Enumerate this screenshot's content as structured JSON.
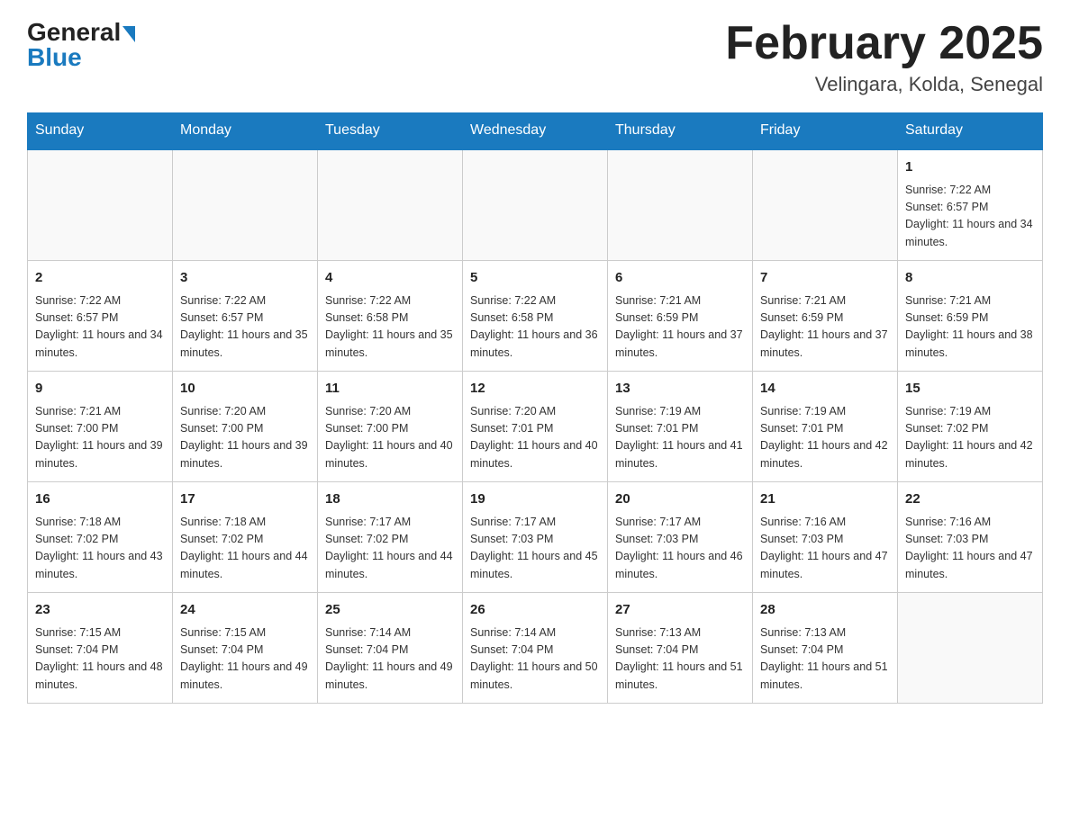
{
  "header": {
    "logo_general": "General",
    "logo_blue": "Blue",
    "title": "February 2025",
    "subtitle": "Velingara, Kolda, Senegal"
  },
  "days_of_week": [
    "Sunday",
    "Monday",
    "Tuesday",
    "Wednesday",
    "Thursday",
    "Friday",
    "Saturday"
  ],
  "weeks": [
    [
      {
        "day": "",
        "info": ""
      },
      {
        "day": "",
        "info": ""
      },
      {
        "day": "",
        "info": ""
      },
      {
        "day": "",
        "info": ""
      },
      {
        "day": "",
        "info": ""
      },
      {
        "day": "",
        "info": ""
      },
      {
        "day": "1",
        "info": "Sunrise: 7:22 AM\nSunset: 6:57 PM\nDaylight: 11 hours and 34 minutes."
      }
    ],
    [
      {
        "day": "2",
        "info": "Sunrise: 7:22 AM\nSunset: 6:57 PM\nDaylight: 11 hours and 34 minutes."
      },
      {
        "day": "3",
        "info": "Sunrise: 7:22 AM\nSunset: 6:57 PM\nDaylight: 11 hours and 35 minutes."
      },
      {
        "day": "4",
        "info": "Sunrise: 7:22 AM\nSunset: 6:58 PM\nDaylight: 11 hours and 35 minutes."
      },
      {
        "day": "5",
        "info": "Sunrise: 7:22 AM\nSunset: 6:58 PM\nDaylight: 11 hours and 36 minutes."
      },
      {
        "day": "6",
        "info": "Sunrise: 7:21 AM\nSunset: 6:59 PM\nDaylight: 11 hours and 37 minutes."
      },
      {
        "day": "7",
        "info": "Sunrise: 7:21 AM\nSunset: 6:59 PM\nDaylight: 11 hours and 37 minutes."
      },
      {
        "day": "8",
        "info": "Sunrise: 7:21 AM\nSunset: 6:59 PM\nDaylight: 11 hours and 38 minutes."
      }
    ],
    [
      {
        "day": "9",
        "info": "Sunrise: 7:21 AM\nSunset: 7:00 PM\nDaylight: 11 hours and 39 minutes."
      },
      {
        "day": "10",
        "info": "Sunrise: 7:20 AM\nSunset: 7:00 PM\nDaylight: 11 hours and 39 minutes."
      },
      {
        "day": "11",
        "info": "Sunrise: 7:20 AM\nSunset: 7:00 PM\nDaylight: 11 hours and 40 minutes."
      },
      {
        "day": "12",
        "info": "Sunrise: 7:20 AM\nSunset: 7:01 PM\nDaylight: 11 hours and 40 minutes."
      },
      {
        "day": "13",
        "info": "Sunrise: 7:19 AM\nSunset: 7:01 PM\nDaylight: 11 hours and 41 minutes."
      },
      {
        "day": "14",
        "info": "Sunrise: 7:19 AM\nSunset: 7:01 PM\nDaylight: 11 hours and 42 minutes."
      },
      {
        "day": "15",
        "info": "Sunrise: 7:19 AM\nSunset: 7:02 PM\nDaylight: 11 hours and 42 minutes."
      }
    ],
    [
      {
        "day": "16",
        "info": "Sunrise: 7:18 AM\nSunset: 7:02 PM\nDaylight: 11 hours and 43 minutes."
      },
      {
        "day": "17",
        "info": "Sunrise: 7:18 AM\nSunset: 7:02 PM\nDaylight: 11 hours and 44 minutes."
      },
      {
        "day": "18",
        "info": "Sunrise: 7:17 AM\nSunset: 7:02 PM\nDaylight: 11 hours and 44 minutes."
      },
      {
        "day": "19",
        "info": "Sunrise: 7:17 AM\nSunset: 7:03 PM\nDaylight: 11 hours and 45 minutes."
      },
      {
        "day": "20",
        "info": "Sunrise: 7:17 AM\nSunset: 7:03 PM\nDaylight: 11 hours and 46 minutes."
      },
      {
        "day": "21",
        "info": "Sunrise: 7:16 AM\nSunset: 7:03 PM\nDaylight: 11 hours and 47 minutes."
      },
      {
        "day": "22",
        "info": "Sunrise: 7:16 AM\nSunset: 7:03 PM\nDaylight: 11 hours and 47 minutes."
      }
    ],
    [
      {
        "day": "23",
        "info": "Sunrise: 7:15 AM\nSunset: 7:04 PM\nDaylight: 11 hours and 48 minutes."
      },
      {
        "day": "24",
        "info": "Sunrise: 7:15 AM\nSunset: 7:04 PM\nDaylight: 11 hours and 49 minutes."
      },
      {
        "day": "25",
        "info": "Sunrise: 7:14 AM\nSunset: 7:04 PM\nDaylight: 11 hours and 49 minutes."
      },
      {
        "day": "26",
        "info": "Sunrise: 7:14 AM\nSunset: 7:04 PM\nDaylight: 11 hours and 50 minutes."
      },
      {
        "day": "27",
        "info": "Sunrise: 7:13 AM\nSunset: 7:04 PM\nDaylight: 11 hours and 51 minutes."
      },
      {
        "day": "28",
        "info": "Sunrise: 7:13 AM\nSunset: 7:04 PM\nDaylight: 11 hours and 51 minutes."
      },
      {
        "day": "",
        "info": ""
      }
    ]
  ]
}
